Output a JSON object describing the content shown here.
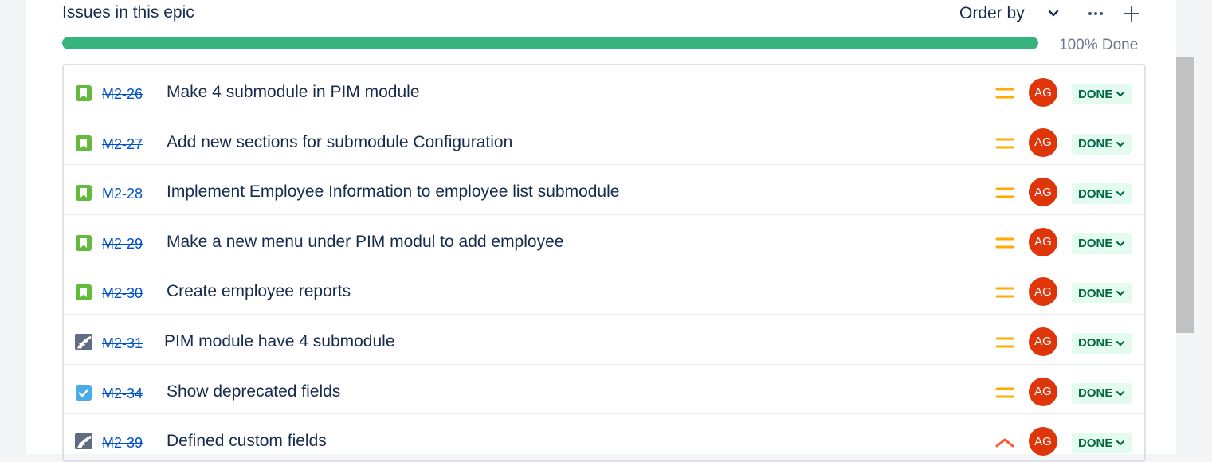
{
  "header": {
    "title": "Issues in this epic",
    "order_by_label": "Order by"
  },
  "progress": {
    "percent": 100,
    "label": "100% Done",
    "color": "#36b37e"
  },
  "issues": [
    {
      "type": "story",
      "key": "M2-26",
      "summary": "Make 4 submodule in PIM module",
      "priority": "medium",
      "assignee": "AG",
      "status": "DONE"
    },
    {
      "type": "story",
      "key": "M2-27",
      "summary": "Add new sections for submodule Configuration",
      "priority": "medium",
      "assignee": "AG",
      "status": "DONE"
    },
    {
      "type": "story",
      "key": "M2-28",
      "summary": "Implement Employee Information to employee list submodule",
      "priority": "medium",
      "assignee": "AG",
      "status": "DONE"
    },
    {
      "type": "story",
      "key": "M2-29",
      "summary": "Make a new menu under PIM modul to add employee",
      "priority": "medium",
      "assignee": "AG",
      "status": "DONE"
    },
    {
      "type": "story",
      "key": "M2-30",
      "summary": "Create employee reports",
      "priority": "medium",
      "assignee": "AG",
      "status": "DONE"
    },
    {
      "type": "feature",
      "key": "M2-31",
      "summary": "PIM module have 4 submodule",
      "priority": "medium",
      "assignee": "AG",
      "status": "DONE"
    },
    {
      "type": "task",
      "key": "M2-34",
      "summary": "Show deprecated fields",
      "priority": "medium",
      "assignee": "AG",
      "status": "DONE"
    },
    {
      "type": "feature",
      "key": "M2-39",
      "summary": "Defined custom fields",
      "priority": "high",
      "assignee": "AG",
      "status": "DONE"
    }
  ],
  "icons": {
    "story": "story-icon",
    "task": "task-icon",
    "feature": "feature-icon",
    "priority_medium": "priority-medium-icon",
    "priority_high": "priority-high-icon",
    "chevron": "chevron-down-icon",
    "more": "more-icon",
    "add": "plus-icon"
  },
  "colors": {
    "story": "#63ba3c",
    "task": "#4bade8",
    "feature": "#42526e",
    "priority_medium": "#ffab00",
    "priority_high": "#ff5630",
    "avatar": "#de350b",
    "status_bg": "#e3fcef",
    "status_text": "#006644",
    "link": "#0052cc"
  }
}
